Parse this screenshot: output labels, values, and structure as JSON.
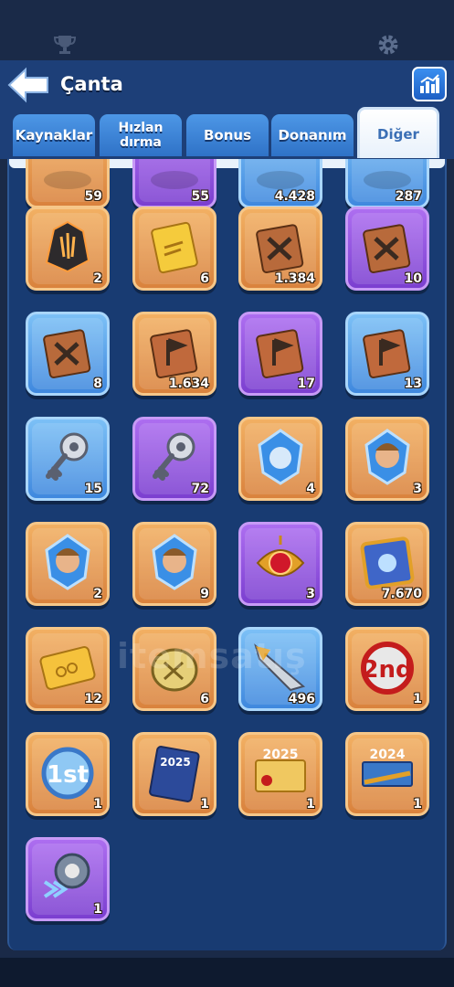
{
  "header": {
    "title": "Çanta"
  },
  "tabs": [
    {
      "label": "Kaynaklar"
    },
    {
      "label": "Hızlan dırma"
    },
    {
      "label": "Bonus"
    },
    {
      "label": "Donanım"
    },
    {
      "label": "Diğer"
    }
  ],
  "active_tab": "Diğer",
  "watermark": "itemsatış",
  "items": [
    {
      "name": "partial-item-1",
      "count": "59",
      "color": "orange",
      "icon": "partial-item"
    },
    {
      "name": "partial-item-2",
      "count": "55",
      "color": "purple",
      "icon": "partial-item"
    },
    {
      "name": "partial-item-3",
      "count": "4.428",
      "color": "blue",
      "icon": "partial-item"
    },
    {
      "name": "partial-item-4",
      "count": "287",
      "color": "blue",
      "icon": "partial-item"
    },
    {
      "name": "fire-crystal-shard",
      "count": "2",
      "color": "orange",
      "icon": "shard-icon"
    },
    {
      "name": "gold-scroll",
      "count": "6",
      "color": "orange",
      "icon": "scroll-icon"
    },
    {
      "name": "brown-battle-book",
      "count": "1.384",
      "color": "orange",
      "icon": "swords-book-icon"
    },
    {
      "name": "purple-battle-book",
      "count": "10",
      "color": "purple",
      "icon": "swords-book-icon"
    },
    {
      "name": "blue-battle-manual",
      "count": "8",
      "color": "blue",
      "icon": "swords-book-icon"
    },
    {
      "name": "brown-flag-book",
      "count": "1.634",
      "color": "orange",
      "icon": "flag-book-icon"
    },
    {
      "name": "purple-flag-book",
      "count": "17",
      "color": "purple",
      "icon": "flag-book-icon"
    },
    {
      "name": "blue-flag-manual",
      "count": "13",
      "color": "blue",
      "icon": "flag-book-icon"
    },
    {
      "name": "silver-key",
      "count": "15",
      "color": "blue",
      "icon": "key-icon"
    },
    {
      "name": "gold-key",
      "count": "72",
      "color": "purple",
      "icon": "key-icon"
    },
    {
      "name": "hero-crystal-generic",
      "count": "4",
      "color": "orange",
      "icon": "crystal-icon"
    },
    {
      "name": "hero-crystal-blonde",
      "count": "3",
      "color": "orange",
      "icon": "hero-crystal-icon"
    },
    {
      "name": "hero-crystal-woman",
      "count": "2",
      "color": "orange",
      "icon": "hero-crystal-icon"
    },
    {
      "name": "hero-crystal-bearded",
      "count": "9",
      "color": "orange",
      "icon": "hero-crystal-icon"
    },
    {
      "name": "red-gem-amulet",
      "count": "3",
      "color": "purple",
      "icon": "amulet-icon"
    },
    {
      "name": "blue-tome",
      "count": "7.670",
      "color": "orange",
      "icon": "tome-icon"
    },
    {
      "name": "gold-ticket",
      "count": "12",
      "color": "orange",
      "icon": "ticket-icon"
    },
    {
      "name": "gold-tag",
      "count": "6",
      "color": "orange",
      "icon": "tag-icon"
    },
    {
      "name": "arrowhead",
      "count": "496",
      "color": "blue",
      "icon": "arrowhead-icon"
    },
    {
      "name": "second-place-badge",
      "count": "1",
      "color": "orange",
      "icon": "badge-2nd-icon"
    },
    {
      "name": "first-place-badge",
      "count": "1",
      "color": "orange",
      "icon": "badge-1st-icon"
    },
    {
      "name": "book-2025",
      "count": "1",
      "color": "orange",
      "icon": "book-2025-icon"
    },
    {
      "name": "certificate-2025",
      "count": "1",
      "color": "orange",
      "icon": "certificate-2025-icon"
    },
    {
      "name": "banner-2024",
      "count": "1",
      "color": "orange",
      "icon": "banner-2024-icon"
    },
    {
      "name": "speed-boost-device",
      "count": "1",
      "color": "purple",
      "icon": "speed-icon"
    }
  ]
}
